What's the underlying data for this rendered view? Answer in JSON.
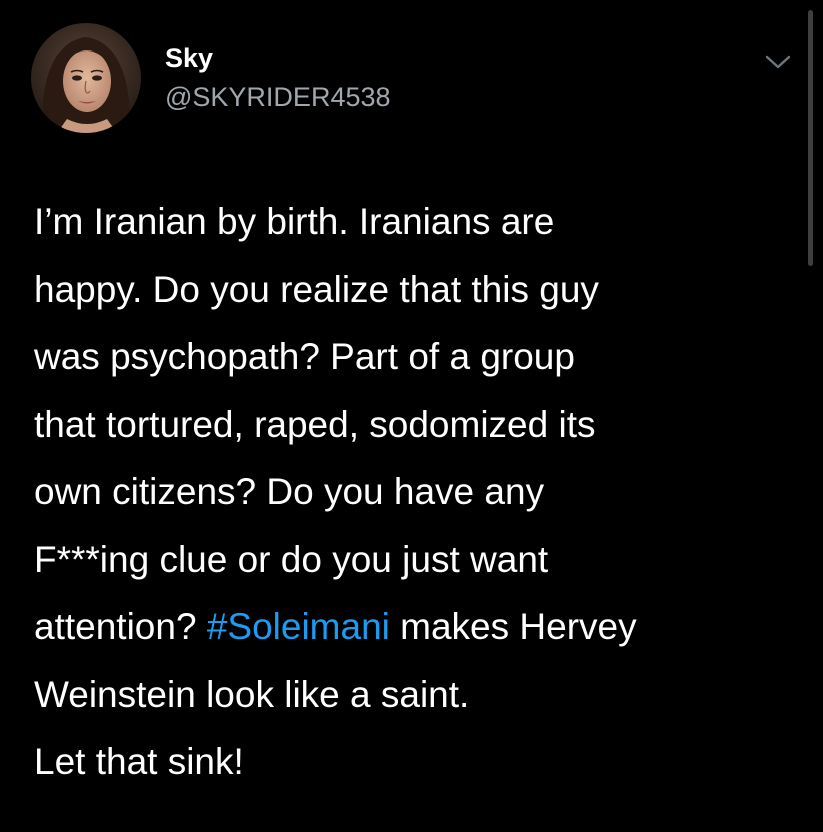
{
  "user": {
    "display_name": "Sky",
    "handle": "@SKYRIDER4538"
  },
  "icons": {
    "avatar": "user-avatar",
    "menu": "chevron-down-icon"
  },
  "tweet": {
    "lines": [
      "I’m Iranian by birth. Iranians are",
      "happy. Do you realize that this guy",
      "was psychopath? Part of a group",
      "that tortured, raped, sodomized its",
      "own citizens? Do you have any",
      "F***ing clue or do you just want"
    ],
    "line7_before": "attention? ",
    "hashtag": "#Soleimani",
    "line7_after": " makes Hervey",
    "line8": "Weinstein look like a saint.",
    "line9": "Let that sink!"
  },
  "colors": {
    "background": "#000000",
    "text": "#ffffff",
    "handle": "#a1a7ad",
    "hashtag": "#1d9bf0"
  }
}
